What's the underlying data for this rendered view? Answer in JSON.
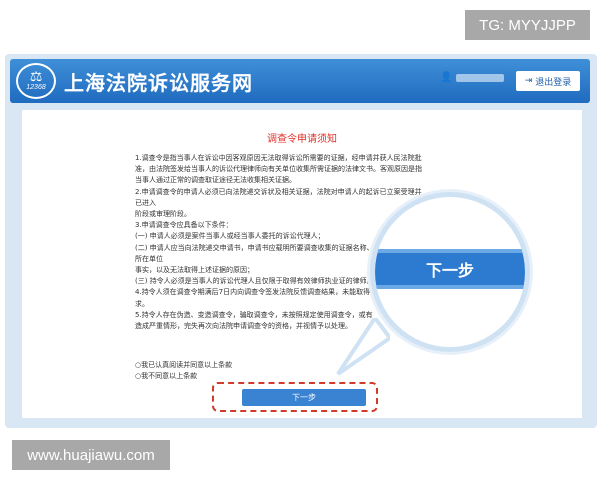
{
  "watermarks": {
    "top": "TG: MYYJJPP",
    "bottom": "www.huajiawu.com"
  },
  "header": {
    "logo_number": "12368",
    "logo_symbol": "⚖",
    "title": "上海法院诉讼服务网",
    "logout_label": "退出登录",
    "colors": {
      "header_bg": "#2a78cb",
      "accent_red": "#e0302a"
    }
  },
  "notice": {
    "title": "调查令申请须知",
    "paragraphs": [
      "1.调查令是指当事人在诉讼中因客观原因无法取得诉讼所需要的证据，经申请并获人民法院批准，由法院签发给当事人的诉讼代理律师向有关单位收集所需证据的法律文书。客观原因是指当事人通过正常的调查取证途径无法收集相关证据。",
      "2.申请调查令的申请人必须已向法院递交诉状及相关证据，法院对申请人的起诉已立案受理并已进入",
      "阶段或审理阶段。",
      "3.申请调查令应具备以下条件：",
      "(一) 申请人必须是案件当事人或经当事人委托的诉讼代理人；",
      "(二) 申请人应当向法院递交申请书，申请书应载明所要调查收集的证据名称、证据内容、证据所在单位",
      "事实，以及无法取得上述证据的原因；",
      "(三) 持令人必须是当事人的诉讼代理人且仅限于取得有效律师执业证的律师。",
      "4.持令人须在调查令期满后7日内向调查令签发法院反馈调查结果，未能取得证据的",
      "求。",
      "5.持令人存在伪造、变造调查令，骗取调查令，未按照规定使用调查令，或有",
      "造成严重情形，完失再次向法院申请调查令的资格，并视情予以处理。"
    ]
  },
  "options": [
    "○我已认真阅读并同意以上条款",
    "○我不同意以上条款"
  ],
  "next_button": "下一步",
  "zoom_callout": {
    "label": "下一步"
  }
}
